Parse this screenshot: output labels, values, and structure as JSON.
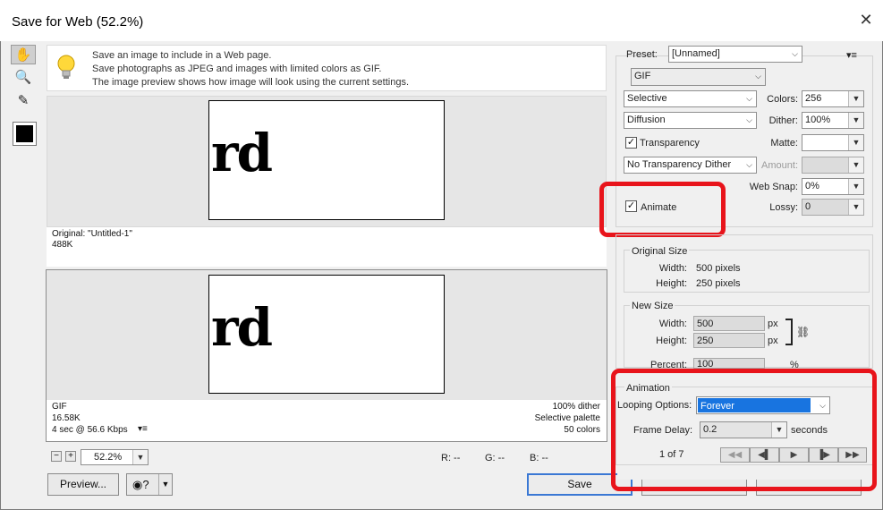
{
  "window": {
    "title": "Save for Web (52.2%)",
    "close_glyph": "✕"
  },
  "tools": [
    {
      "name": "hand-tool",
      "glyph": "✋"
    },
    {
      "name": "zoom-tool",
      "glyph": "🔍"
    },
    {
      "name": "eyedropper-tool",
      "glyph": "✎"
    }
  ],
  "tip": {
    "line1": "Save an image to include in a Web page.",
    "line2": "Save photographs as JPEG and images with limited colors as GIF.",
    "line3": "The image preview shows how image will look using the current settings."
  },
  "preview": {
    "artwork_text": "rd",
    "original": {
      "label": "Original: \"Untitled-1\"",
      "size": "488K"
    },
    "optimized": {
      "format": "GIF",
      "size": "16.58K",
      "speed": "4 sec @ 56.6 Kbps",
      "dither": "100% dither",
      "palette": "Selective palette",
      "colors": "50 colors"
    }
  },
  "zoom": {
    "minus": "−",
    "plus": "+",
    "value": "52.2%"
  },
  "pixel_readout": {
    "r": "R: --",
    "g": "G: --",
    "b": "B: --"
  },
  "buttons": {
    "preview": "Preview...",
    "save": "Save"
  },
  "settings": {
    "preset_label": "Preset:",
    "preset_value": "[Unnamed]",
    "format": "GIF",
    "reduction": "Selective",
    "colors_label": "Colors:",
    "colors_value": "256",
    "dither_algo": "Diffusion",
    "dither_label": "Dither:",
    "dither_value": "100%",
    "transparency_label": "Transparency",
    "transparency_checked": true,
    "matte_label": "Matte:",
    "matte_value": "",
    "transparency_dither": "No Transparency Dither",
    "amount_label": "Amount:",
    "amount_value": "",
    "websnap_label": "Web Snap:",
    "websnap_value": "0%",
    "animate_label": "Animate",
    "animate_checked": true,
    "lossy_label": "Lossy:",
    "lossy_value": "0"
  },
  "image_size": {
    "original_title": "Original Size",
    "orig_width_label": "Width:",
    "orig_width": "500 pixels",
    "orig_height_label": "Height:",
    "orig_height": "250 pixels",
    "new_title": "New Size",
    "width_label": "Width:",
    "width_value": "500",
    "width_unit": "px",
    "height_label": "Height:",
    "height_value": "250",
    "height_unit": "px",
    "percent_label": "Percent:",
    "percent_value": "100",
    "percent_unit": "%"
  },
  "animation": {
    "title": "Animation",
    "looping_label": "Looping Options:",
    "looping_value": "Forever",
    "delay_label": "Frame Delay:",
    "delay_value": "0.2",
    "delay_unit": "seconds",
    "frame_counter": "1 of 7",
    "nav": {
      "first": "◀◀",
      "prev": "◀▌",
      "play": "▶",
      "next": "▐▶",
      "last": "▶▶"
    }
  },
  "colors": {
    "highlight": "#e8141b",
    "selection": "#1874e0",
    "focus": "#3a78d4"
  }
}
